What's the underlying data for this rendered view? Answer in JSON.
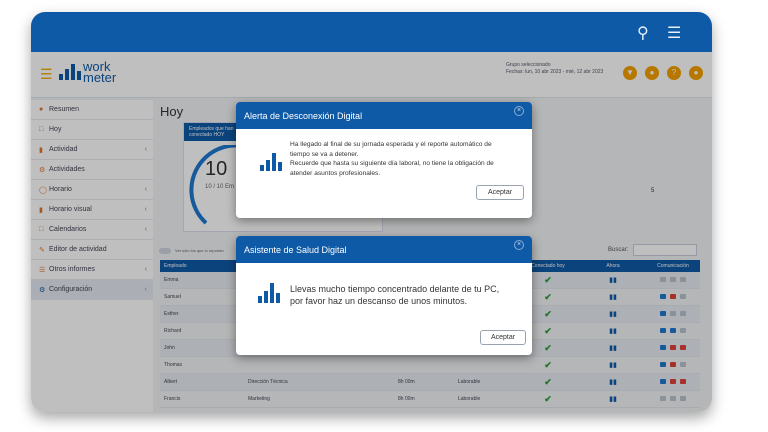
{
  "topbar": {
    "search_icon": "search-icon",
    "menu_icon": "menu-icon"
  },
  "header": {
    "logo_text_1": "work",
    "logo_text_2": "meter",
    "group_line": "Grupo seleccionado",
    "dates_line": "Fechas: lun, 10 abr 2023 - mié, 12 abr 2023"
  },
  "sidebar": {
    "items": [
      {
        "label": "Resumen"
      },
      {
        "label": "Hoy"
      },
      {
        "label": "Actividad"
      },
      {
        "label": "Actividades"
      },
      {
        "label": "Horario"
      },
      {
        "label": "Horario visual"
      },
      {
        "label": "Calendarios"
      },
      {
        "label": "Editor de actividad"
      },
      {
        "label": "Otros informes"
      },
      {
        "label": "Configuración"
      }
    ]
  },
  "main": {
    "title": "Hoy",
    "card_header": "Empleados que han\nconectado HOY",
    "big_number": "10",
    "big_sub": "10 / 10 Em",
    "right_number": "5",
    "toggle_label": "Ver sólo los que lo reportan",
    "search_label": "Buscar:"
  },
  "table": {
    "headers": [
      "Empleado",
      "",
      "",
      "",
      "Conectado hoy",
      "Ahora",
      "Comunicación"
    ],
    "rows": [
      {
        "name": "Emma",
        "dept": "",
        "hours": "",
        "type": ""
      },
      {
        "name": "Samuel",
        "dept": "",
        "hours": "",
        "type": ""
      },
      {
        "name": "Esther",
        "dept": "",
        "hours": "",
        "type": ""
      },
      {
        "name": "Richard",
        "dept": "",
        "hours": "",
        "type": ""
      },
      {
        "name": "John",
        "dept": "",
        "hours": "",
        "type": ""
      },
      {
        "name": "Thomas",
        "dept": "",
        "hours": "",
        "type": ""
      },
      {
        "name": "Albert",
        "dept": "Dirección Técnica",
        "hours": "8h 00m",
        "type": "Laborable"
      },
      {
        "name": "Francis",
        "dept": "Marketing",
        "hours": "8h 00m",
        "type": "Laborable"
      }
    ]
  },
  "modal1": {
    "title": "Alerta de Desconexión Digital",
    "line1": "Ha llegado al final de su jornada esperada y el reporte automático de",
    "line2": "tiempo se va a detener.",
    "line3": "Recuerde que hasta su siguiente día laboral, no tiene la obligación de",
    "line4": "atender asuntos profesionales.",
    "button": "Aceptar"
  },
  "modal2": {
    "title": "Asistente de Salud Digital",
    "line1": "Llevas mucho tiempo concentrado delante de tu PC,",
    "line2": "por favor haz un descanso de unos minutos.",
    "button": "Aceptar"
  },
  "colors": {
    "brand": "#0f5aa6",
    "accent": "#f5a000",
    "check": "#2e9e3a"
  }
}
